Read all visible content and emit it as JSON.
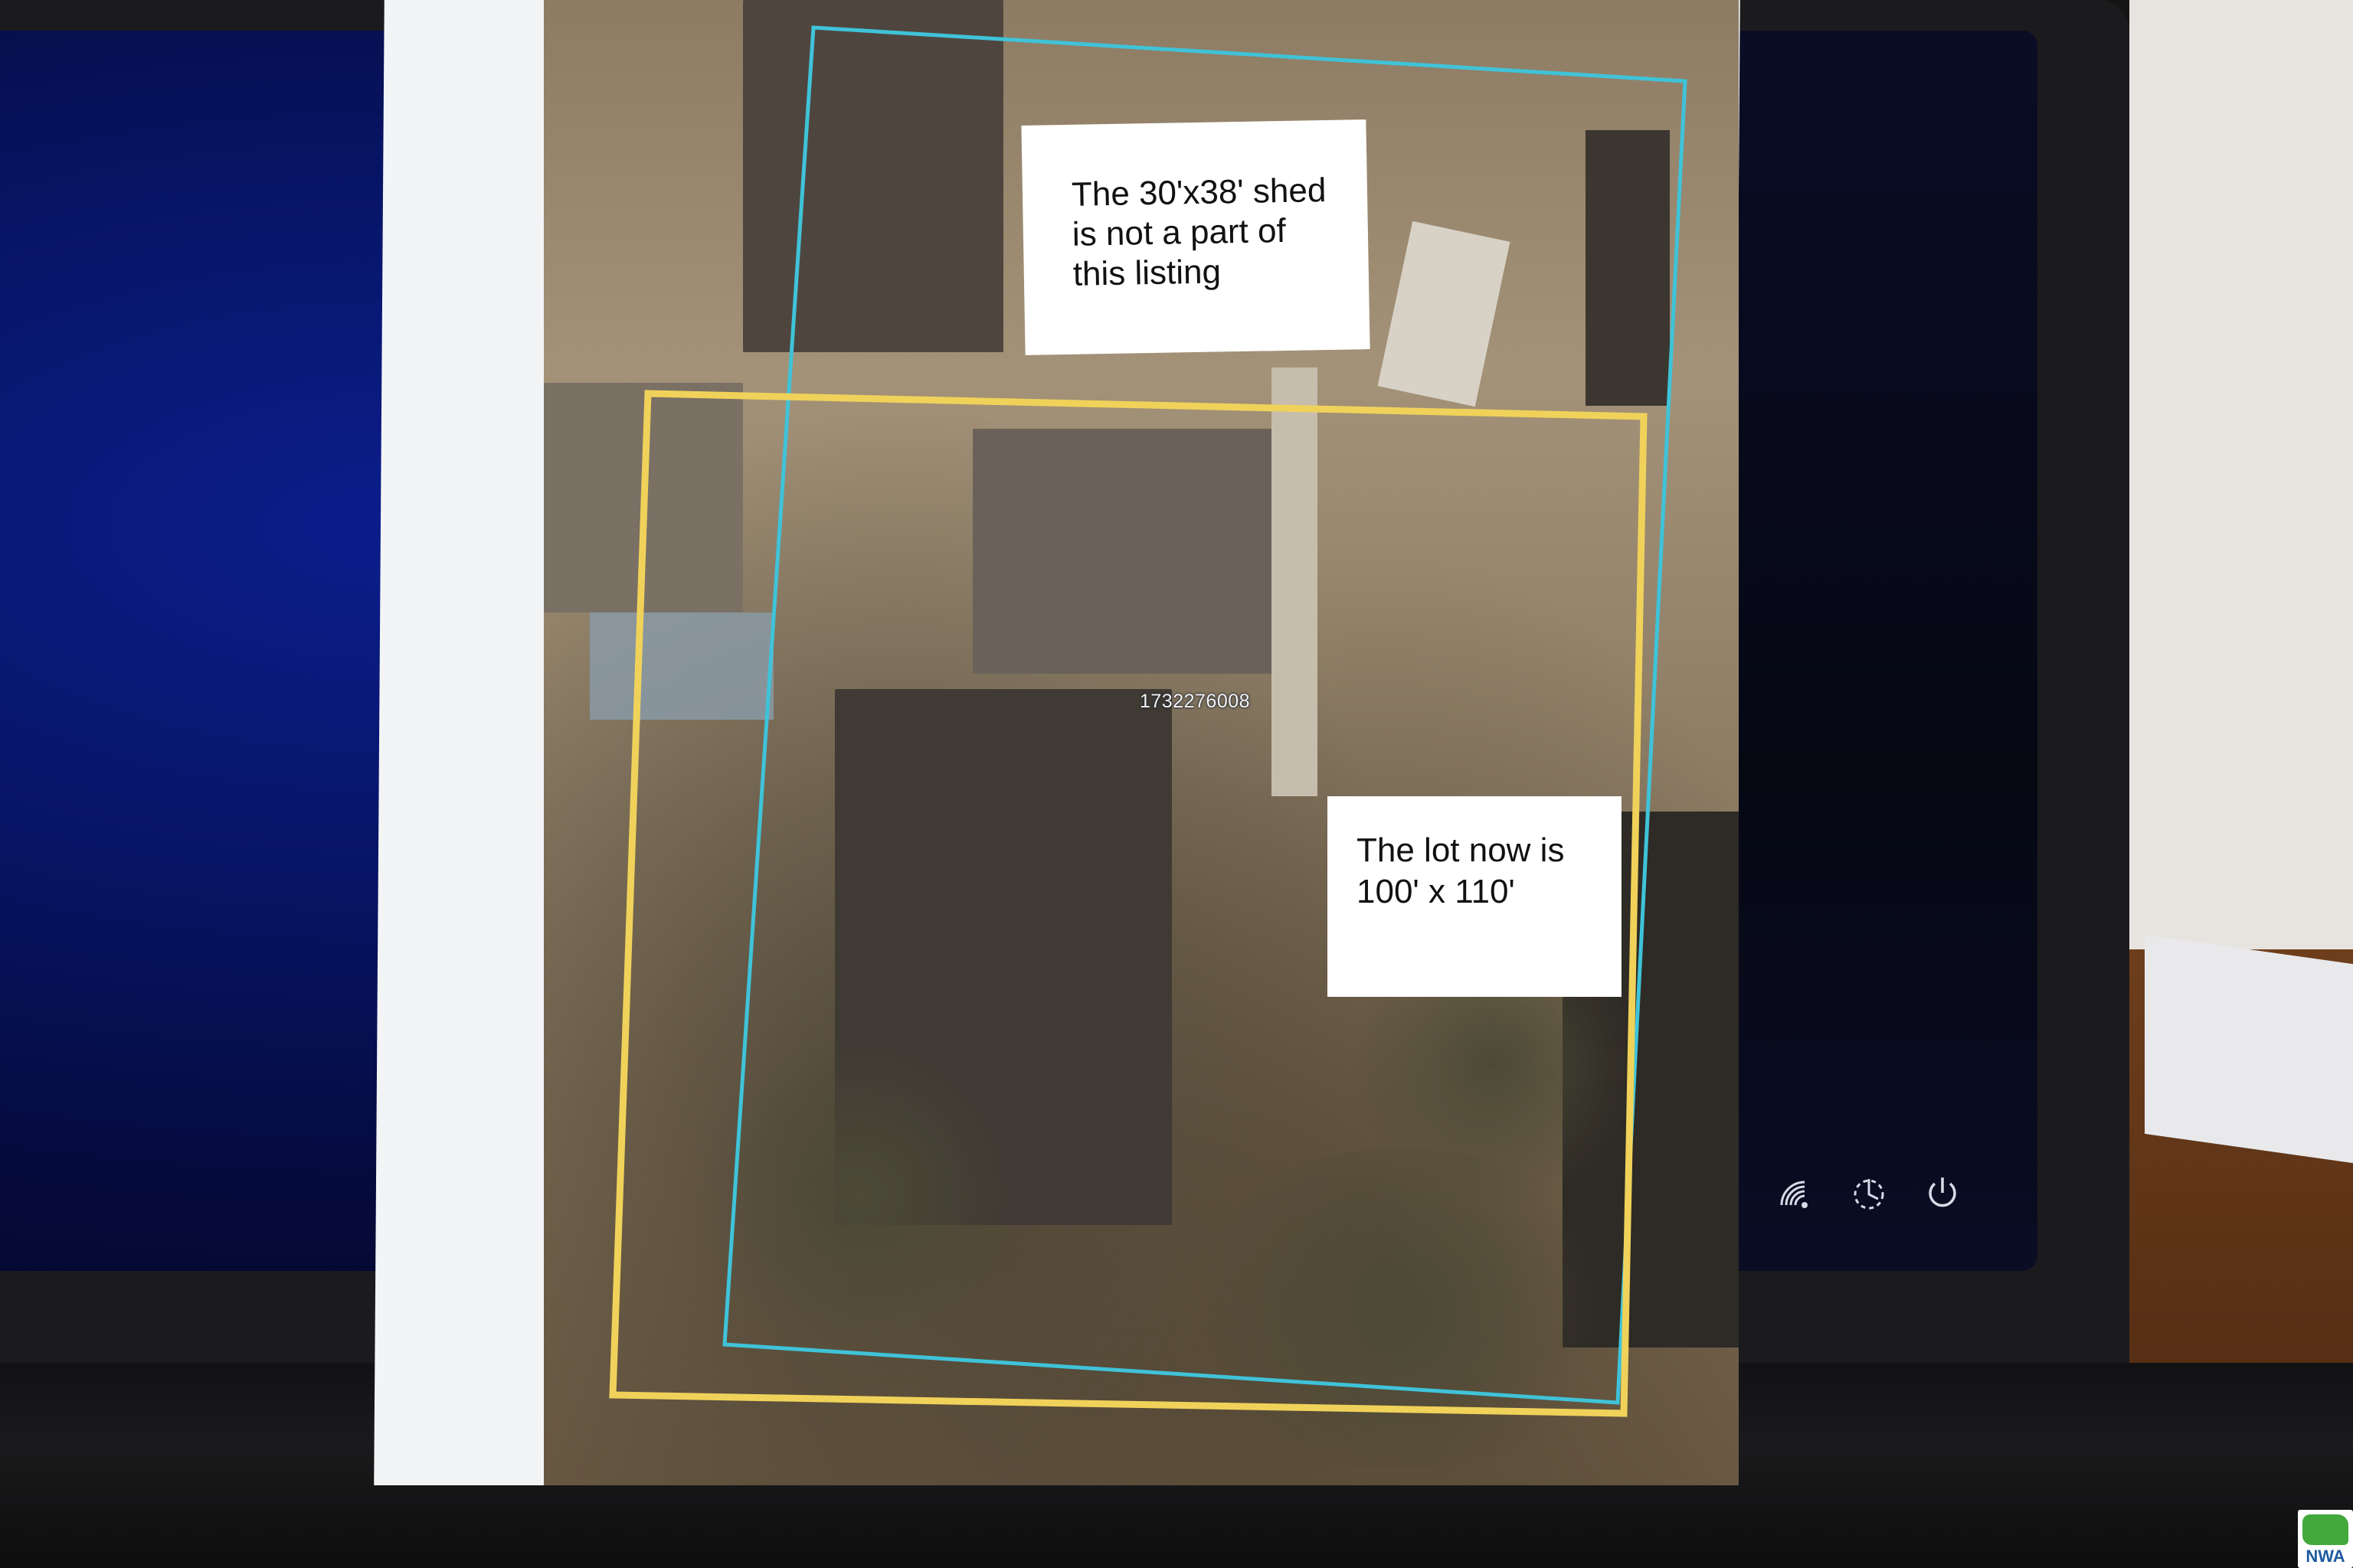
{
  "photo": {
    "shed_note": [
      "The 30'x38' shed",
      "is not a part of",
      "this listing"
    ],
    "lot_note": [
      "The lot now is",
      "100' x 110'"
    ],
    "parcel_id": "1732276008"
  },
  "overlay_colors": {
    "old_boundary": "#3fc3d9",
    "new_lot_boundary": "#f0d25a"
  },
  "tray_icons": [
    "wifi-icon",
    "accessibility-icon",
    "power-icon"
  ],
  "watermark": {
    "text": "NWA"
  }
}
